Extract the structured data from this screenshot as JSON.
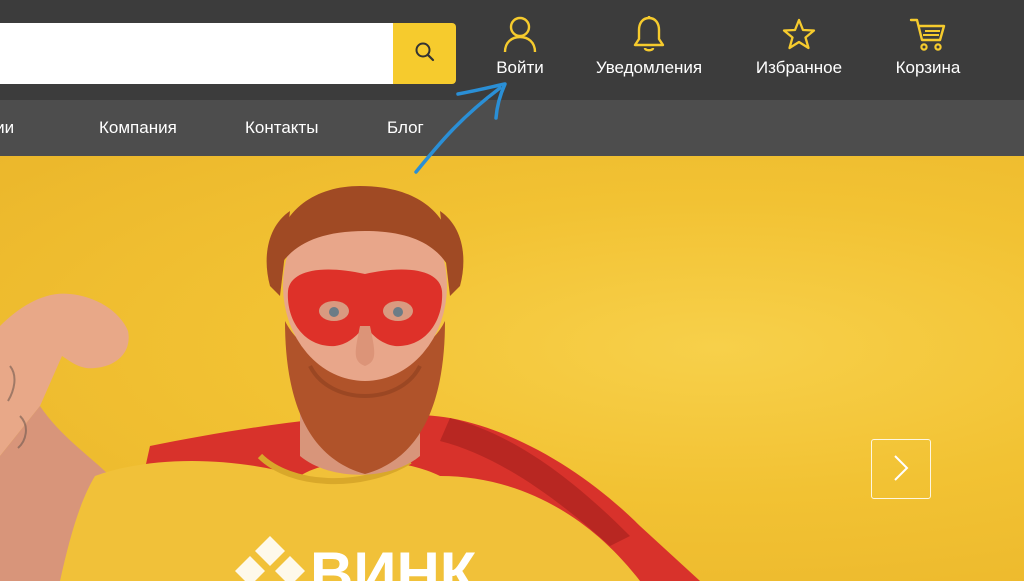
{
  "search": {
    "value": "",
    "placeholder": ""
  },
  "header": {
    "actions": [
      {
        "label": "Войти",
        "icon": "user-icon"
      },
      {
        "label": "Уведомления",
        "icon": "bell-icon"
      },
      {
        "label": "Избранное",
        "icon": "star-icon"
      },
      {
        "label": "Корзина",
        "icon": "cart-icon"
      }
    ]
  },
  "menu": {
    "items": [
      {
        "label": "кции"
      },
      {
        "label": "Компания"
      },
      {
        "label": "Контакты"
      },
      {
        "label": "Блог"
      }
    ]
  },
  "hero": {
    "shirt_logo_text": "ВИНК"
  },
  "colors": {
    "accent": "#f6cb2d",
    "header_bg": "#3c3c3c",
    "menu_bg": "#4d4d4d",
    "hero_bg": "#f2c233",
    "annotation_arrow": "#2a8fd6"
  }
}
